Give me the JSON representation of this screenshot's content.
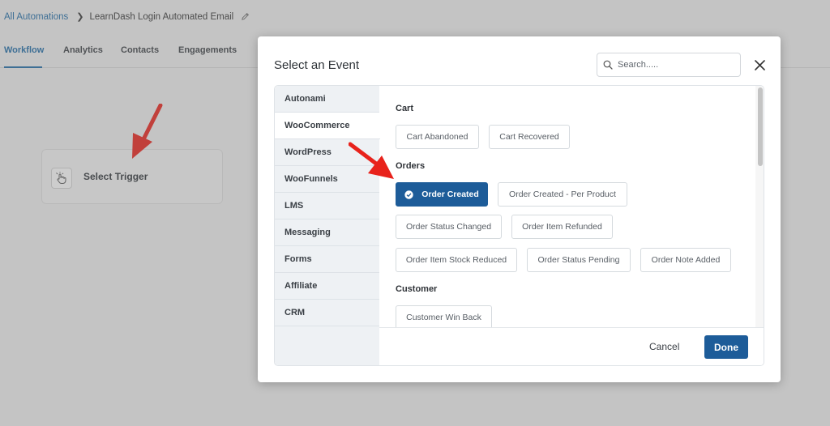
{
  "breadcrumb": {
    "parent": "All Automations",
    "current": "LearnDash Login Automated Email"
  },
  "tabs": [
    "Workflow",
    "Analytics",
    "Contacts",
    "Engagements"
  ],
  "trigger_card": {
    "label": "Select Trigger"
  },
  "modal": {
    "title": "Select an Event",
    "search_placeholder": "Search.....",
    "sidebar": [
      "Autonami",
      "WooCommerce",
      "WordPress",
      "WooFunnels",
      "LMS",
      "Messaging",
      "Forms",
      "Affiliate",
      "CRM"
    ],
    "active_category": "WooCommerce",
    "sections": {
      "cart": {
        "title": "Cart",
        "events": [
          "Cart Abandoned",
          "Cart Recovered"
        ]
      },
      "orders": {
        "title": "Orders",
        "events": [
          "Order Created",
          "Order Created - Per Product",
          "Order Status Changed",
          "Order Item Refunded",
          "Order Item Stock Reduced",
          "Order Status Pending",
          "Order Note Added"
        ]
      },
      "customer": {
        "title": "Customer",
        "events": [
          "Customer Win Back"
        ]
      }
    },
    "selected_event": "Order Created",
    "cancel_label": "Cancel",
    "done_label": "Done"
  },
  "colors": {
    "primary": "#1d5c99",
    "link": "#1f6aa5",
    "annotation_arrow": "#e8221b"
  }
}
